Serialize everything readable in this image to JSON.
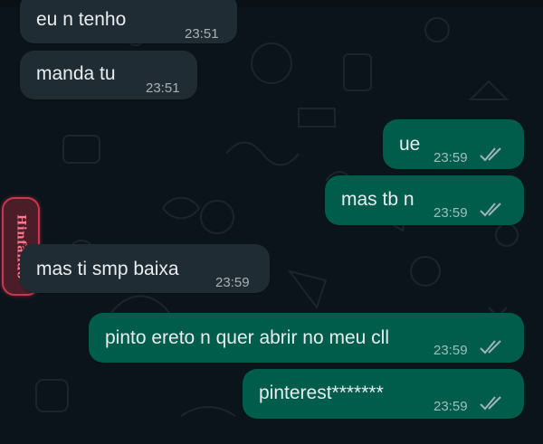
{
  "theme": {
    "incoming_bubble": "#1f2c34",
    "outgoing_bubble": "#005c4b",
    "wallpaper": "#0b141a",
    "read_ticks": "#9fb4bd"
  },
  "sticker": {
    "text": "Hinfando",
    "icon": "sticker-logo"
  },
  "messages": [
    {
      "direction": "incoming",
      "text": "eu n tenho",
      "time": "23:51",
      "read": false
    },
    {
      "direction": "incoming",
      "text": "manda tu",
      "time": "23:51",
      "read": false
    },
    {
      "direction": "outgoing",
      "text": "ue",
      "time": "23:59",
      "read": true
    },
    {
      "direction": "outgoing",
      "text": "mas tb n",
      "time": "23:59",
      "read": true
    },
    {
      "direction": "incoming",
      "text": "mas ti smp baixa",
      "time": "23:59",
      "read": false
    },
    {
      "direction": "outgoing",
      "text": "pinto ereto n quer abrir no meu cll",
      "time": "23:59",
      "read": true
    },
    {
      "direction": "outgoing",
      "text": "pinterest*******",
      "time": "23:59",
      "read": true
    }
  ]
}
